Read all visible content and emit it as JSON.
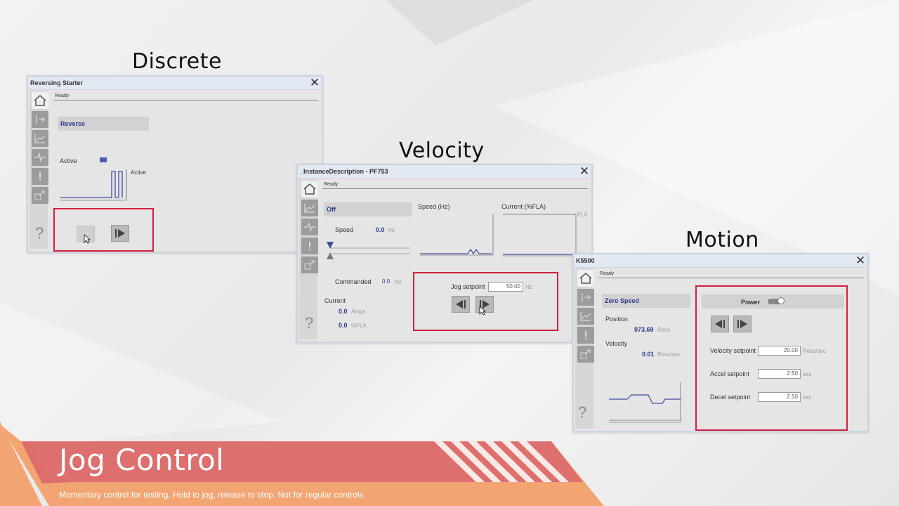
{
  "headings": {
    "discrete": "Discrete",
    "velocity": "Velocity",
    "motion": "Motion"
  },
  "discrete": {
    "title": "Reversing Starter",
    "status": "Ready",
    "mode_label": "Reverse",
    "active_label": "Active",
    "trend_label": "Active"
  },
  "velocity": {
    "title": "_InstanceDescription - PF753",
    "status": "Ready",
    "state_label": "Off",
    "speed_label": "Speed",
    "speed_value": "0.0",
    "speed_unit": "Hz",
    "speed_trend_label": "Speed (Hz)",
    "current_trend_label": "Current (%FLA)",
    "fla_axis_label": "FLA",
    "commanded_label": "Commanded",
    "commanded_value": "0.0",
    "commanded_unit": "Hz",
    "current_label": "Current",
    "current_amps_value": "0.0",
    "current_amps_unit": "Amps",
    "current_fla_value": "0.0",
    "current_fla_unit": "%FLA",
    "jog_setpoint_label": "Jog setpoint",
    "jog_setpoint_value": "50.00",
    "jog_setpoint_unit": "Hz"
  },
  "motion": {
    "title": "K5500",
    "status": "Ready",
    "state_label": "Zero Speed",
    "position_label": "Position",
    "position_value": "973.69",
    "position_unit": "Revs",
    "velocity_label": "Velocity",
    "velocity_value": "0.01",
    "velocity_unit": "Revs/sec",
    "power_label": "Power",
    "velocity_setpoint_label": "Velocity setpoint",
    "velocity_setpoint_value": "20.00",
    "velocity_setpoint_unit": "Revs/sec",
    "accel_setpoint_label": "Accel setpoint",
    "accel_setpoint_value": "2.50",
    "accel_setpoint_unit": "sec",
    "decel_setpoint_label": "Decel setpoint",
    "decel_setpoint_value": "2.50",
    "decel_setpoint_unit": "sec"
  },
  "banner": {
    "title": "Jog Control",
    "subtitle": "Momentary control for testing. Hold to jog, release to stop. Not for regular controls."
  },
  "colors": {
    "highlight": "#d2203a",
    "value_blue": "#2a3b8f",
    "banner_orange": "#f2a472",
    "banner_red": "#d9646a"
  }
}
